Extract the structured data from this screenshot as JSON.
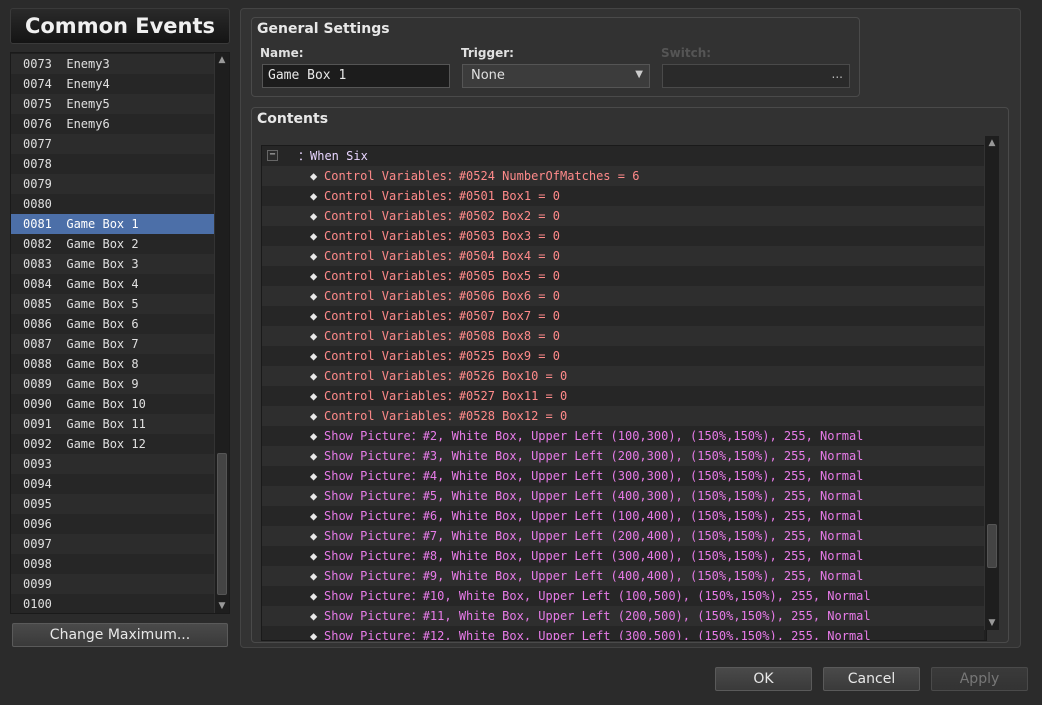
{
  "window": {
    "title": "Common Events"
  },
  "event_list": {
    "rows": [
      {
        "id": "0073",
        "name": "Enemy3"
      },
      {
        "id": "0074",
        "name": "Enemy4"
      },
      {
        "id": "0075",
        "name": "Enemy5"
      },
      {
        "id": "0076",
        "name": "Enemy6"
      },
      {
        "id": "0077",
        "name": ""
      },
      {
        "id": "0078",
        "name": ""
      },
      {
        "id": "0079",
        "name": ""
      },
      {
        "id": "0080",
        "name": ""
      },
      {
        "id": "0081",
        "name": "Game Box 1"
      },
      {
        "id": "0082",
        "name": "Game Box 2"
      },
      {
        "id": "0083",
        "name": "Game Box 3"
      },
      {
        "id": "0084",
        "name": "Game Box 4"
      },
      {
        "id": "0085",
        "name": "Game Box 5"
      },
      {
        "id": "0086",
        "name": "Game Box 6"
      },
      {
        "id": "0087",
        "name": "Game Box 7"
      },
      {
        "id": "0088",
        "name": "Game Box 8"
      },
      {
        "id": "0089",
        "name": "Game Box 9"
      },
      {
        "id": "0090",
        "name": "Game Box 10"
      },
      {
        "id": "0091",
        "name": "Game Box 11"
      },
      {
        "id": "0092",
        "name": "Game Box 12"
      },
      {
        "id": "0093",
        "name": ""
      },
      {
        "id": "0094",
        "name": ""
      },
      {
        "id": "0095",
        "name": ""
      },
      {
        "id": "0096",
        "name": ""
      },
      {
        "id": "0097",
        "name": ""
      },
      {
        "id": "0098",
        "name": ""
      },
      {
        "id": "0099",
        "name": ""
      },
      {
        "id": "0100",
        "name": ""
      }
    ],
    "selected_id": "0081"
  },
  "buttons": {
    "change_maximum": "Change Maximum...",
    "ok": "OK",
    "cancel": "Cancel",
    "apply": "Apply"
  },
  "general_settings": {
    "title": "General Settings",
    "name_label": "Name:",
    "name_value": "Game Box 1",
    "trigger_label": "Trigger:",
    "trigger_value": "None",
    "switch_label": "Switch:",
    "switch_button": "..."
  },
  "contents": {
    "title": "Contents",
    "collapse_symbol": "−",
    "commands": [
      {
        "type": "branch",
        "text": "：When Six"
      },
      {
        "type": "var",
        "text": "Control Variables：#0524 NumberOfMatches = 6"
      },
      {
        "type": "var",
        "text": "Control Variables：#0501 Box1 = 0"
      },
      {
        "type": "var",
        "text": "Control Variables：#0502 Box2 = 0"
      },
      {
        "type": "var",
        "text": "Control Variables：#0503 Box3 = 0"
      },
      {
        "type": "var",
        "text": "Control Variables：#0504 Box4 = 0"
      },
      {
        "type": "var",
        "text": "Control Variables：#0505 Box5 = 0"
      },
      {
        "type": "var",
        "text": "Control Variables：#0506 Box6 = 0"
      },
      {
        "type": "var",
        "text": "Control Variables：#0507 Box7 = 0"
      },
      {
        "type": "var",
        "text": "Control Variables：#0508 Box8 = 0"
      },
      {
        "type": "var",
        "text": "Control Variables：#0525 Box9 = 0"
      },
      {
        "type": "var",
        "text": "Control Variables：#0526 Box10 = 0"
      },
      {
        "type": "var",
        "text": "Control Variables：#0527 Box11 = 0"
      },
      {
        "type": "var",
        "text": "Control Variables：#0528 Box12 = 0"
      },
      {
        "type": "pic",
        "text": "Show Picture：#2, White Box, Upper Left (100,300), (150%,150%), 255, Normal"
      },
      {
        "type": "pic",
        "text": "Show Picture：#3, White Box, Upper Left (200,300), (150%,150%), 255, Normal"
      },
      {
        "type": "pic",
        "text": "Show Picture：#4, White Box, Upper Left (300,300), (150%,150%), 255, Normal"
      },
      {
        "type": "pic",
        "text": "Show Picture：#5, White Box, Upper Left (400,300), (150%,150%), 255, Normal"
      },
      {
        "type": "pic",
        "text": "Show Picture：#6, White Box, Upper Left (100,400), (150%,150%), 255, Normal"
      },
      {
        "type": "pic",
        "text": "Show Picture：#7, White Box, Upper Left (200,400), (150%,150%), 255, Normal"
      },
      {
        "type": "pic",
        "text": "Show Picture：#8, White Box, Upper Left (300,400), (150%,150%), 255, Normal"
      },
      {
        "type": "pic",
        "text": "Show Picture：#9, White Box, Upper Left (400,400), (150%,150%), 255, Normal"
      },
      {
        "type": "pic",
        "text": "Show Picture：#10, White Box, Upper Left (100,500), (150%,150%), 255, Normal"
      },
      {
        "type": "pic",
        "text": "Show Picture：#11, White Box, Upper Left (200,500), (150%,150%), 255, Normal"
      },
      {
        "type": "pic",
        "text": "Show Picture：#12, White Box, Upper Left (300,500), (150%,150%), 255, Normal"
      }
    ]
  },
  "icons": {
    "diamond": "◆",
    "scroll_up": "▲",
    "scroll_down": "▼",
    "dropdown_caret": "▼"
  },
  "colors": {
    "selection": "#4c6fa8",
    "variable_command": "#ff8a8a",
    "picture_command": "#e77be8"
  }
}
